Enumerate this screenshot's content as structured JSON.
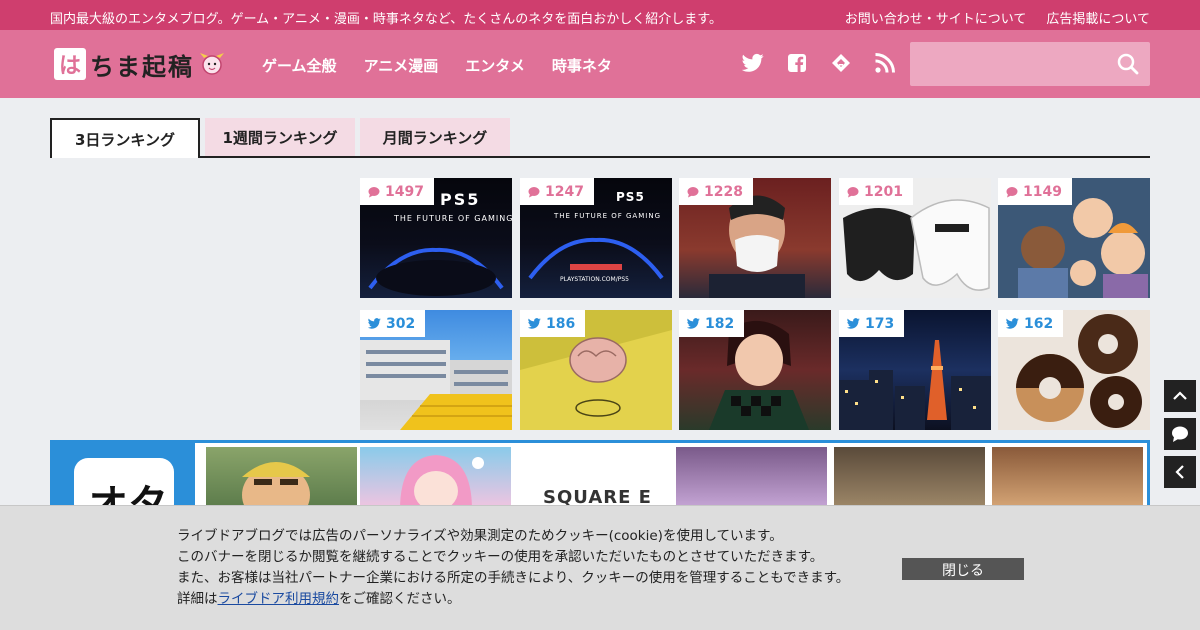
{
  "topbar": {
    "tagline": "国内最大級のエンタメブログ。ゲーム・アニメ・漫画・時事ネタなど、たくさんのネタを面白おかしく紹介します。",
    "links": [
      "お問い合わせ・サイトについて",
      "広告掲載について"
    ]
  },
  "header": {
    "logo_mark": "は",
    "logo_text": "ちま起稿",
    "nav": [
      "ゲーム全般",
      "アニメ漫画",
      "エンタメ",
      "時事ネタ"
    ],
    "social_icons": [
      "twitter-icon",
      "facebook-icon",
      "feedly-icon",
      "rss-icon"
    ],
    "search_placeholder": ""
  },
  "tabs": [
    "3日ランキング",
    "1週間ランキング",
    "月間ランキング"
  ],
  "ranking": {
    "comments": [
      {
        "count": "1497",
        "caption": "PS5",
        "subcaption": "THE FUTURE OF GAMING",
        "color": "#0a0b14"
      },
      {
        "count": "1247",
        "caption": "PS5",
        "subcaption": "THE FUTURE OF GAMING",
        "subcaption2": "PLAYSTATION.COM/PS5",
        "color": "#0a0b14"
      },
      {
        "count": "1228",
        "color": "#7a2a2a"
      },
      {
        "count": "1201",
        "color": "#e6e6e6"
      },
      {
        "count": "1149",
        "color": "#3d5a7a"
      }
    ],
    "tweets": [
      {
        "count": "302",
        "color": "#4b8fd6"
      },
      {
        "count": "186",
        "color": "#d8c54a"
      },
      {
        "count": "182",
        "color": "#2e4a3a"
      },
      {
        "count": "173",
        "color": "#1a2a4a"
      },
      {
        "count": "162",
        "color": "#e8e0d8"
      }
    ]
  },
  "blogbox": {
    "badge": "オタ",
    "strip_text": "SQUARE E"
  },
  "side_buttons": [
    "chevron-up-icon",
    "comment-icon",
    "chevron-left-icon"
  ],
  "cookie": {
    "line1": "ライブドアブログでは広告のパーソナライズや効果測定のためクッキー(cookie)を使用しています。",
    "line2": "このバナーを閉じるか閲覧を継続することでクッキーの使用を承認いただいたものとさせていただきます。",
    "line3": "また、お客様は当社パートナー企業における所定の手続きにより、クッキーの使用を管理することもできます。",
    "line4_prefix": "詳細は",
    "line4_link": "ライブドア利用規約",
    "line4_suffix": "をご確認ください。",
    "close_label": "閉じる"
  },
  "colors": {
    "topbar": "#cf3e6e",
    "header": "#e07198",
    "comment_badge": "#e07198",
    "tweet_badge": "#2b8fd9",
    "blogbox": "#2b8fd9"
  }
}
